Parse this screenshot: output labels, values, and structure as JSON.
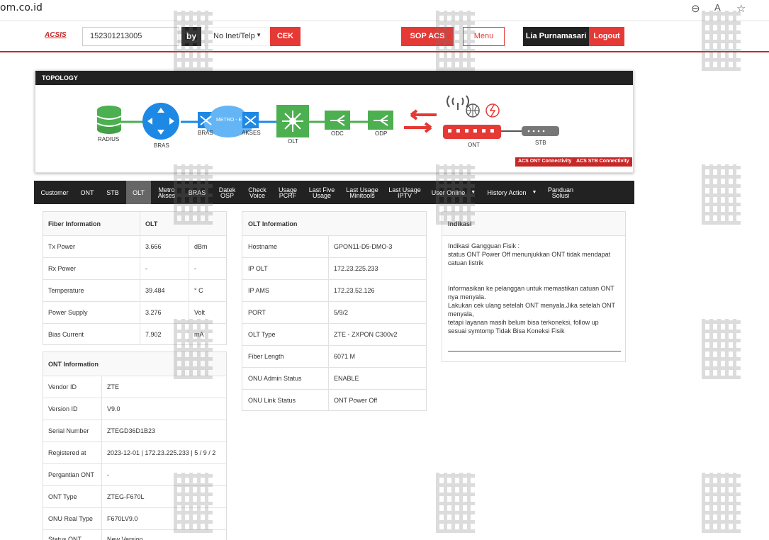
{
  "browser": {
    "url": "om.co.id"
  },
  "header": {
    "logo": "ACSIS",
    "customer_value": "152301213005",
    "by_label": "by",
    "select_value": "No Inet/Telp",
    "cek_label": "CEK",
    "sop_label": "SOP ACS",
    "menu_label": "Menu",
    "user_name": "Lia Purnamasari",
    "logout_label": "Logout"
  },
  "topology": {
    "title": "TOPOLOGY",
    "nodes": {
      "radius": "RADIUS",
      "bras": "BRAS",
      "bras2": "BRAS",
      "metro_cloud": "METRO - E",
      "akses": "AKSES",
      "olt": "OLT",
      "odc": "ODC",
      "odp": "ODP",
      "ont": "ONT",
      "stb": "STB"
    },
    "buttons": {
      "acs_ont": "ACS ONT Connectivity",
      "acs_stb": "ACS STB Connectivity"
    }
  },
  "tabs": [
    {
      "l1": "Customer"
    },
    {
      "l1": "ONT"
    },
    {
      "l1": "STB"
    },
    {
      "l1": "OLT"
    },
    {
      "l1": "Metro",
      "l2": "Akses"
    },
    {
      "l1": "BRAS"
    },
    {
      "l1": "Datek",
      "l2": "OSP"
    },
    {
      "l1": "Check",
      "l2": "Voice"
    },
    {
      "l1": "Usage",
      "l2": "PCRF"
    },
    {
      "l1": "Last Five",
      "l2": "Usage"
    },
    {
      "l1": "Last Usage",
      "l2": "Minitools"
    },
    {
      "l1": "Last Usage",
      "l2": "IPTV"
    },
    {
      "l1": "User Online"
    },
    {
      "l1": "History Action"
    },
    {
      "l1": "Panduan",
      "l2": "Solusi"
    }
  ],
  "fiber": {
    "h1": "Fiber Information",
    "h2": "OLT",
    "rows": [
      {
        "label": "Tx Power",
        "value": "3.666",
        "unit": "dBm"
      },
      {
        "label": "Rx Power",
        "value": "-",
        "unit": "-"
      },
      {
        "label": "Temperature",
        "value": "39.484",
        "unit": "° C"
      },
      {
        "label": "Power Supply",
        "value": "3.276",
        "unit": "Volt"
      },
      {
        "label": "Bias Current",
        "value": "7.902",
        "unit": "mA"
      }
    ]
  },
  "ont": {
    "title": "ONT Information",
    "rows": [
      {
        "label": "Vendor ID",
        "value": "ZTE"
      },
      {
        "label": "Version ID",
        "value": "V9.0"
      },
      {
        "label": "Serial Number",
        "value": "ZTEGD36D1B23"
      },
      {
        "label": "Registered at",
        "value": "2023-12-01 | 172.23.225.233 | 5 / 9 / 2"
      },
      {
        "label": "Pergantian ONT",
        "value": "-"
      },
      {
        "label": "ONT Type",
        "value": "ZTEG-F670L"
      },
      {
        "label": "ONU Real Type",
        "value": "F670LV9.0"
      },
      {
        "label": "Status ONT",
        "value": "New Version"
      }
    ]
  },
  "olt": {
    "title": "OLT Information",
    "rows": [
      {
        "label": "Hostname",
        "value": "GPON11-D5-DMO-3"
      },
      {
        "label": "IP OLT",
        "value": "172.23.225.233"
      },
      {
        "label": "IP AMS",
        "value": "172.23.52.126"
      },
      {
        "label": "PORT",
        "value": "5/9/2"
      },
      {
        "label": "OLT Type",
        "value": "ZTE - ZXPON C300v2"
      },
      {
        "label": "Fiber Length",
        "value": "6071 M"
      },
      {
        "label": "ONU Admin Status",
        "value": "ENABLE"
      },
      {
        "label": "ONU Link Status",
        "value": "ONT Power Off"
      }
    ]
  },
  "indikasi": {
    "title": "Indikasi",
    "lines": [
      "Indikasi Gangguan Fisik :",
      "status ONT Power Off menunjukkan ONT tidak mendapat",
      "catuan listrik",
      "",
      "",
      "Informasikan ke pelanggan untuk memastikan catuan ONT",
      "nya menyala.",
      "Lakukan cek ulang setelah ONT menyala.Jika setelah ONT",
      "menyala,",
      "tetapi layanan masih belum bisa terkoneksi, follow up",
      "sesuai symtomp Tidak Bisa Koneksi Fisik"
    ]
  },
  "colors": {
    "accent": "#e53935",
    "dark": "#222222",
    "node_green": "#4caf50",
    "node_blue": "#1e88e5",
    "cloud_blue": "#64b5f6"
  }
}
